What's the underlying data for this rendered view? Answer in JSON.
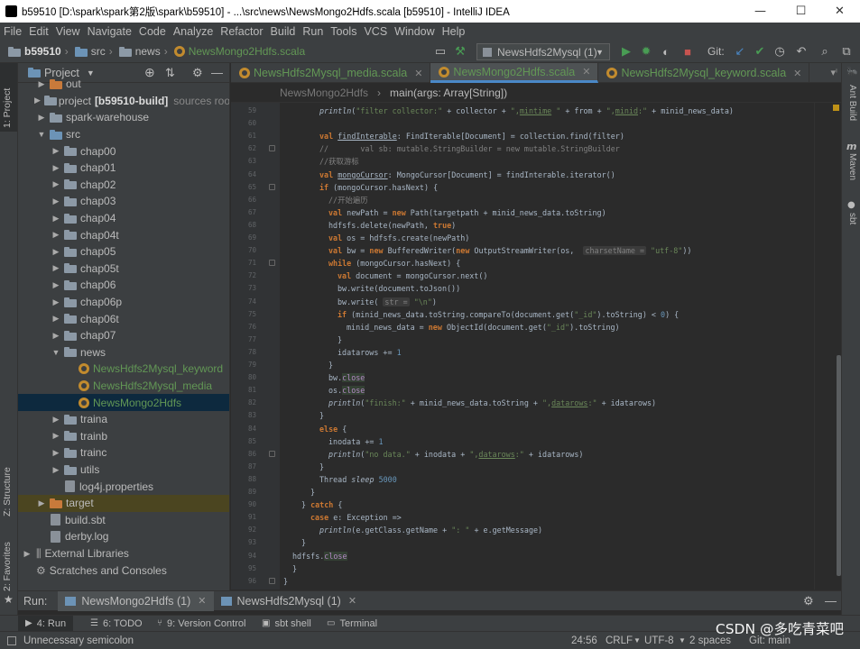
{
  "window": {
    "title": "b59510 [D:\\spark\\spark第2版\\spark\\b59510] - ...\\src\\news\\NewsMongo2Hdfs.scala [b59510] - IntelliJ IDEA",
    "min": "—",
    "max": "☐",
    "close": "✕"
  },
  "menu": [
    "File",
    "Edit",
    "View",
    "Navigate",
    "Code",
    "Analyze",
    "Refactor",
    "Build",
    "Run",
    "Tools",
    "VCS",
    "Window",
    "Help"
  ],
  "nav": {
    "crumbs": [
      "b59510",
      "src",
      "news",
      "NewsMongo2Hdfs.scala"
    ],
    "run_config": "NewsHdfs2Mysql (1)",
    "git_label": "Git:"
  },
  "left_tabs": {
    "project": "1: Project",
    "structure": "Z: Structure",
    "favorites": "2: Favorites"
  },
  "right_tabs": {
    "ant": "Ant Build",
    "maven": "Maven",
    "sbt": "sbt"
  },
  "project": {
    "header": "Project",
    "tree": [
      {
        "label": "out",
        "depth": 1,
        "arrow": "▶",
        "icon": "orange"
      },
      {
        "label": "project",
        "bold_suffix": "[b59510-build]",
        "suffix": "sources roo",
        "depth": 1,
        "arrow": "▶",
        "icon": "gray"
      },
      {
        "label": "spark-warehouse",
        "depth": 1,
        "arrow": "▶",
        "icon": "gray"
      },
      {
        "label": "src",
        "depth": 1,
        "arrow": "▼",
        "icon": "blue"
      },
      {
        "label": "chap00",
        "depth": 2,
        "arrow": "▶",
        "icon": "gray"
      },
      {
        "label": "chap01",
        "depth": 2,
        "arrow": "▶",
        "icon": "gray"
      },
      {
        "label": "chap02",
        "depth": 2,
        "arrow": "▶",
        "icon": "gray"
      },
      {
        "label": "chap03",
        "depth": 2,
        "arrow": "▶",
        "icon": "gray"
      },
      {
        "label": "chap04",
        "depth": 2,
        "arrow": "▶",
        "icon": "gray"
      },
      {
        "label": "chap04t",
        "depth": 2,
        "arrow": "▶",
        "icon": "gray"
      },
      {
        "label": "chap05",
        "depth": 2,
        "arrow": "▶",
        "icon": "gray"
      },
      {
        "label": "chap05t",
        "depth": 2,
        "arrow": "▶",
        "icon": "gray"
      },
      {
        "label": "chap06",
        "depth": 2,
        "arrow": "▶",
        "icon": "gray"
      },
      {
        "label": "chap06p",
        "depth": 2,
        "arrow": "▶",
        "icon": "gray"
      },
      {
        "label": "chap06t",
        "depth": 2,
        "arrow": "▶",
        "icon": "gray"
      },
      {
        "label": "chap07",
        "depth": 2,
        "arrow": "▶",
        "icon": "gray"
      },
      {
        "label": "news",
        "depth": 2,
        "arrow": "▼",
        "icon": "gray"
      },
      {
        "label": "NewsHdfs2Mysql_keyword",
        "depth": 3,
        "arrow": "",
        "icon": "scala",
        "color": "#629755"
      },
      {
        "label": "NewsHdfs2Mysql_media",
        "depth": 3,
        "arrow": "",
        "icon": "scala",
        "color": "#629755"
      },
      {
        "label": "NewsMongo2Hdfs",
        "depth": 3,
        "arrow": "",
        "icon": "scala",
        "color": "#629755",
        "selected": true
      },
      {
        "label": "traina",
        "depth": 2,
        "arrow": "▶",
        "icon": "gray"
      },
      {
        "label": "trainb",
        "depth": 2,
        "arrow": "▶",
        "icon": "gray"
      },
      {
        "label": "trainc",
        "depth": 2,
        "arrow": "▶",
        "icon": "gray"
      },
      {
        "label": "utils",
        "depth": 2,
        "arrow": "▶",
        "icon": "gray"
      },
      {
        "label": "log4j.properties",
        "depth": 2,
        "arrow": "",
        "icon": "file"
      },
      {
        "label": "target",
        "depth": 1,
        "arrow": "▶",
        "icon": "orange",
        "highlight": true
      },
      {
        "label": "build.sbt",
        "depth": 1,
        "arrow": "",
        "icon": "file"
      },
      {
        "label": "derby.log",
        "depth": 1,
        "arrow": "",
        "icon": "file"
      },
      {
        "label": "External Libraries",
        "depth": 0,
        "arrow": "▶",
        "icon": "lib"
      },
      {
        "label": "Scratches and Consoles",
        "depth": 0,
        "arrow": "",
        "icon": "scratch"
      }
    ]
  },
  "editor_tabs": [
    {
      "label": "NewsHdfs2Mysql_media.scala",
      "active": false
    },
    {
      "label": "NewsMongo2Hdfs.scala",
      "active": true
    },
    {
      "label": "NewsHdfs2Mysql_keyword.scala",
      "active": false
    }
  ],
  "editor_crumbs": {
    "object": "NewsMongo2Hdfs",
    "method": "main(args: Array[String])"
  },
  "code_lines": [
    {
      "n": "59",
      "indent": 4,
      "html": "<span class=\"fn\">println</span>(<span class=\"str\">\"filter collector:\"</span> + collector + <span class=\"str\">\",<span class=\"ul\">mintime</span> \"</span> + from + <span class=\"str\">\",<span class=\"ul\">minid</span>:\"</span> + minid_news_data)"
    },
    {
      "n": "60",
      "indent": 0,
      "html": ""
    },
    {
      "n": "61",
      "indent": 4,
      "html": "<span class=\"kw\">val</span> <span class=\"ul\">findInterable</span>: FindIterable[Document] = collection.find(filter)"
    },
    {
      "n": "62",
      "indent": 4,
      "html": "<span class=\"cm\">//       val sb: mutable.StringBuilder = new mutable.StringBuilder</span>"
    },
    {
      "n": "63",
      "indent": 4,
      "html": "<span class=\"cm\">//获取游标</span>"
    },
    {
      "n": "64",
      "indent": 4,
      "html": "<span class=\"kw\">val</span> <span class=\"ul\">mongoCursor</span>: MongoCursor[Document] = findInterable.iterator()"
    },
    {
      "n": "65",
      "indent": 4,
      "html": "<span class=\"kw\">if</span> (mongoCursor.hasNext) {"
    },
    {
      "n": "66",
      "indent": 5,
      "html": "<span class=\"cm\">//开始遍历</span>"
    },
    {
      "n": "67",
      "indent": 5,
      "html": "<span class=\"kw\">val</span> newPath = <span class=\"kw\">new</span> Path(targetpath + minid_news_data.toString)"
    },
    {
      "n": "68",
      "indent": 5,
      "html": "hdfsfs.delete(newPath, <span class=\"kw\">true</span>)"
    },
    {
      "n": "69",
      "indent": 5,
      "html": "<span class=\"kw\">val</span> os = hdfsfs.create(newPath)"
    },
    {
      "n": "70",
      "indent": 5,
      "html": "<span class=\"kw\">val</span> bw = <span class=\"kw\">new</span> BufferedWriter(<span class=\"kw\">new</span> OutputStreamWriter(os,  <span class=\"hint\">charsetName =</span> <span class=\"str\">\"utf-8\"</span>))"
    },
    {
      "n": "71",
      "indent": 5,
      "html": "<span class=\"kw\">while</span> (mongoCursor.hasNext) {"
    },
    {
      "n": "72",
      "indent": 6,
      "html": "<span class=\"kw\">val</span> document = mongoCursor.next()"
    },
    {
      "n": "73",
      "indent": 6,
      "html": "bw.write(document.toJson())"
    },
    {
      "n": "74",
      "indent": 6,
      "html": "bw.write( <span class=\"hint\">str =</span> <span class=\"str\">\"\\n\"</span>)"
    },
    {
      "n": "75",
      "indent": 6,
      "html": "<span class=\"kw\">if</span> (minid_news_data.toString.compareTo(document.get(<span class=\"str\">\"_id\"</span>).toString) &lt; <span class=\"num\">0</span>) {"
    },
    {
      "n": "76",
      "indent": 7,
      "html": "minid_news_data = <span class=\"kw\">new</span> ObjectId(document.get(<span class=\"str\">\"_id\"</span>).toString)"
    },
    {
      "n": "77",
      "indent": 6,
      "html": "}"
    },
    {
      "n": "78",
      "indent": 6,
      "html": "idatarows += <span class=\"num\">1</span>"
    },
    {
      "n": "79",
      "indent": 5,
      "html": "}"
    },
    {
      "n": "80",
      "indent": 5,
      "html": "bw.<span class=\"dv\">close</span>"
    },
    {
      "n": "81",
      "indent": 5,
      "html": "os.<span class=\"dv\">close</span>"
    },
    {
      "n": "82",
      "indent": 5,
      "html": "<span class=\"fn\">println</span>(<span class=\"str\">\"finish:\"</span> + minid_news_data.toString + <span class=\"str\">\",<span class=\"ul\">datarows</span>:\"</span> + idatarows)"
    },
    {
      "n": "83",
      "indent": 4,
      "html": "}"
    },
    {
      "n": "84",
      "indent": 4,
      "html": "<span class=\"kw\">else</span> {"
    },
    {
      "n": "85",
      "indent": 5,
      "html": "inodata += <span class=\"num\">1</span>"
    },
    {
      "n": "86",
      "indent": 5,
      "html": "<span class=\"fn\">println</span>(<span class=\"str\">\"no data.\"</span> + inodata + <span class=\"str\">\",<span class=\"ul\">datarows</span>:\"</span> + idatarows)"
    },
    {
      "n": "87",
      "indent": 4,
      "html": "}"
    },
    {
      "n": "88",
      "indent": 4,
      "html": "Thread <span class=\"fn\">sleep</span> <span class=\"num\">5000</span>"
    },
    {
      "n": "89",
      "indent": 3,
      "html": "}"
    },
    {
      "n": "90",
      "indent": 2,
      "html": "} <span class=\"kw\">catch</span> {"
    },
    {
      "n": "91",
      "indent": 3,
      "html": "<span class=\"kw\">case</span> e: Exception =&gt;"
    },
    {
      "n": "92",
      "indent": 4,
      "html": "<span class=\"fn\">println</span>(e.getClass.getName + <span class=\"str\">\": \"</span> + e.getMessage)"
    },
    {
      "n": "93",
      "indent": 2,
      "html": "}"
    },
    {
      "n": "94",
      "indent": 1,
      "html": "hdfsfs.<span class=\"dv\">close</span>"
    },
    {
      "n": "95",
      "indent": 1,
      "html": "}"
    },
    {
      "n": "96",
      "indent": 0,
      "html": "}"
    },
    {
      "n": "97",
      "indent": 0,
      "html": ""
    }
  ],
  "run_panel": {
    "label": "Run:",
    "tabs": [
      {
        "label": "NewsMongo2Hdfs (1)",
        "active": true
      },
      {
        "label": "NewsHdfs2Mysql (1)",
        "active": false
      }
    ]
  },
  "bottom_tools": [
    {
      "label": "4: Run",
      "active": true,
      "icon": "▶"
    },
    {
      "label": "6: TODO",
      "active": false,
      "icon": "☰"
    },
    {
      "label": "9: Version Control",
      "active": false,
      "icon": "⑂"
    },
    {
      "label": "sbt shell",
      "active": false,
      "icon": "▣"
    },
    {
      "label": "Terminal",
      "active": false,
      "icon": "▭"
    }
  ],
  "status": {
    "message": "Unnecessary semicolon",
    "position": "24:56",
    "line_sep": "CRLF",
    "encoding": "UTF-8",
    "indent": "2 spaces",
    "git": "Git: main"
  },
  "watermark": "CSDN @多吃青菜吧",
  "colors": {
    "accent": "#4a88c7",
    "run_green": "#499c54",
    "stop_red": "#c75450",
    "scala_file": "#629755"
  }
}
